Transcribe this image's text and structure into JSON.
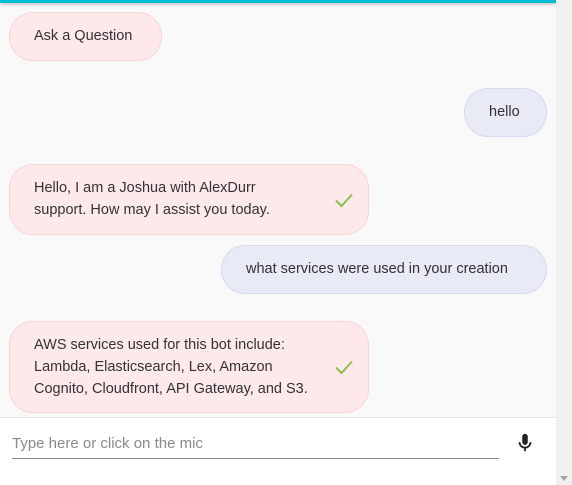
{
  "chat": {
    "messages": [
      {
        "role": "bot",
        "text": "Ask a Question",
        "delivered": false
      },
      {
        "role": "user",
        "text": "hello"
      },
      {
        "role": "bot",
        "text": "Hello, I am a Joshua with AlexDurr\nsupport. How may I assist you today.",
        "delivered": true
      },
      {
        "role": "user",
        "text": "what services were used in your creation"
      },
      {
        "role": "bot",
        "text": "AWS services used for this bot include:\nLambda, Elasticsearch, Lex, Amazon\nCognito, Cloudfront, API Gateway, and S3.",
        "delivered": true
      }
    ]
  },
  "input": {
    "placeholder": "Type here or click on the mic",
    "value": "",
    "mic_icon": "microphone-icon"
  },
  "colors": {
    "accent": "#00bcd4",
    "bot_bubble": "#fde8ea",
    "user_bubble": "#e8eaf6",
    "check": "#8bc34a"
  }
}
